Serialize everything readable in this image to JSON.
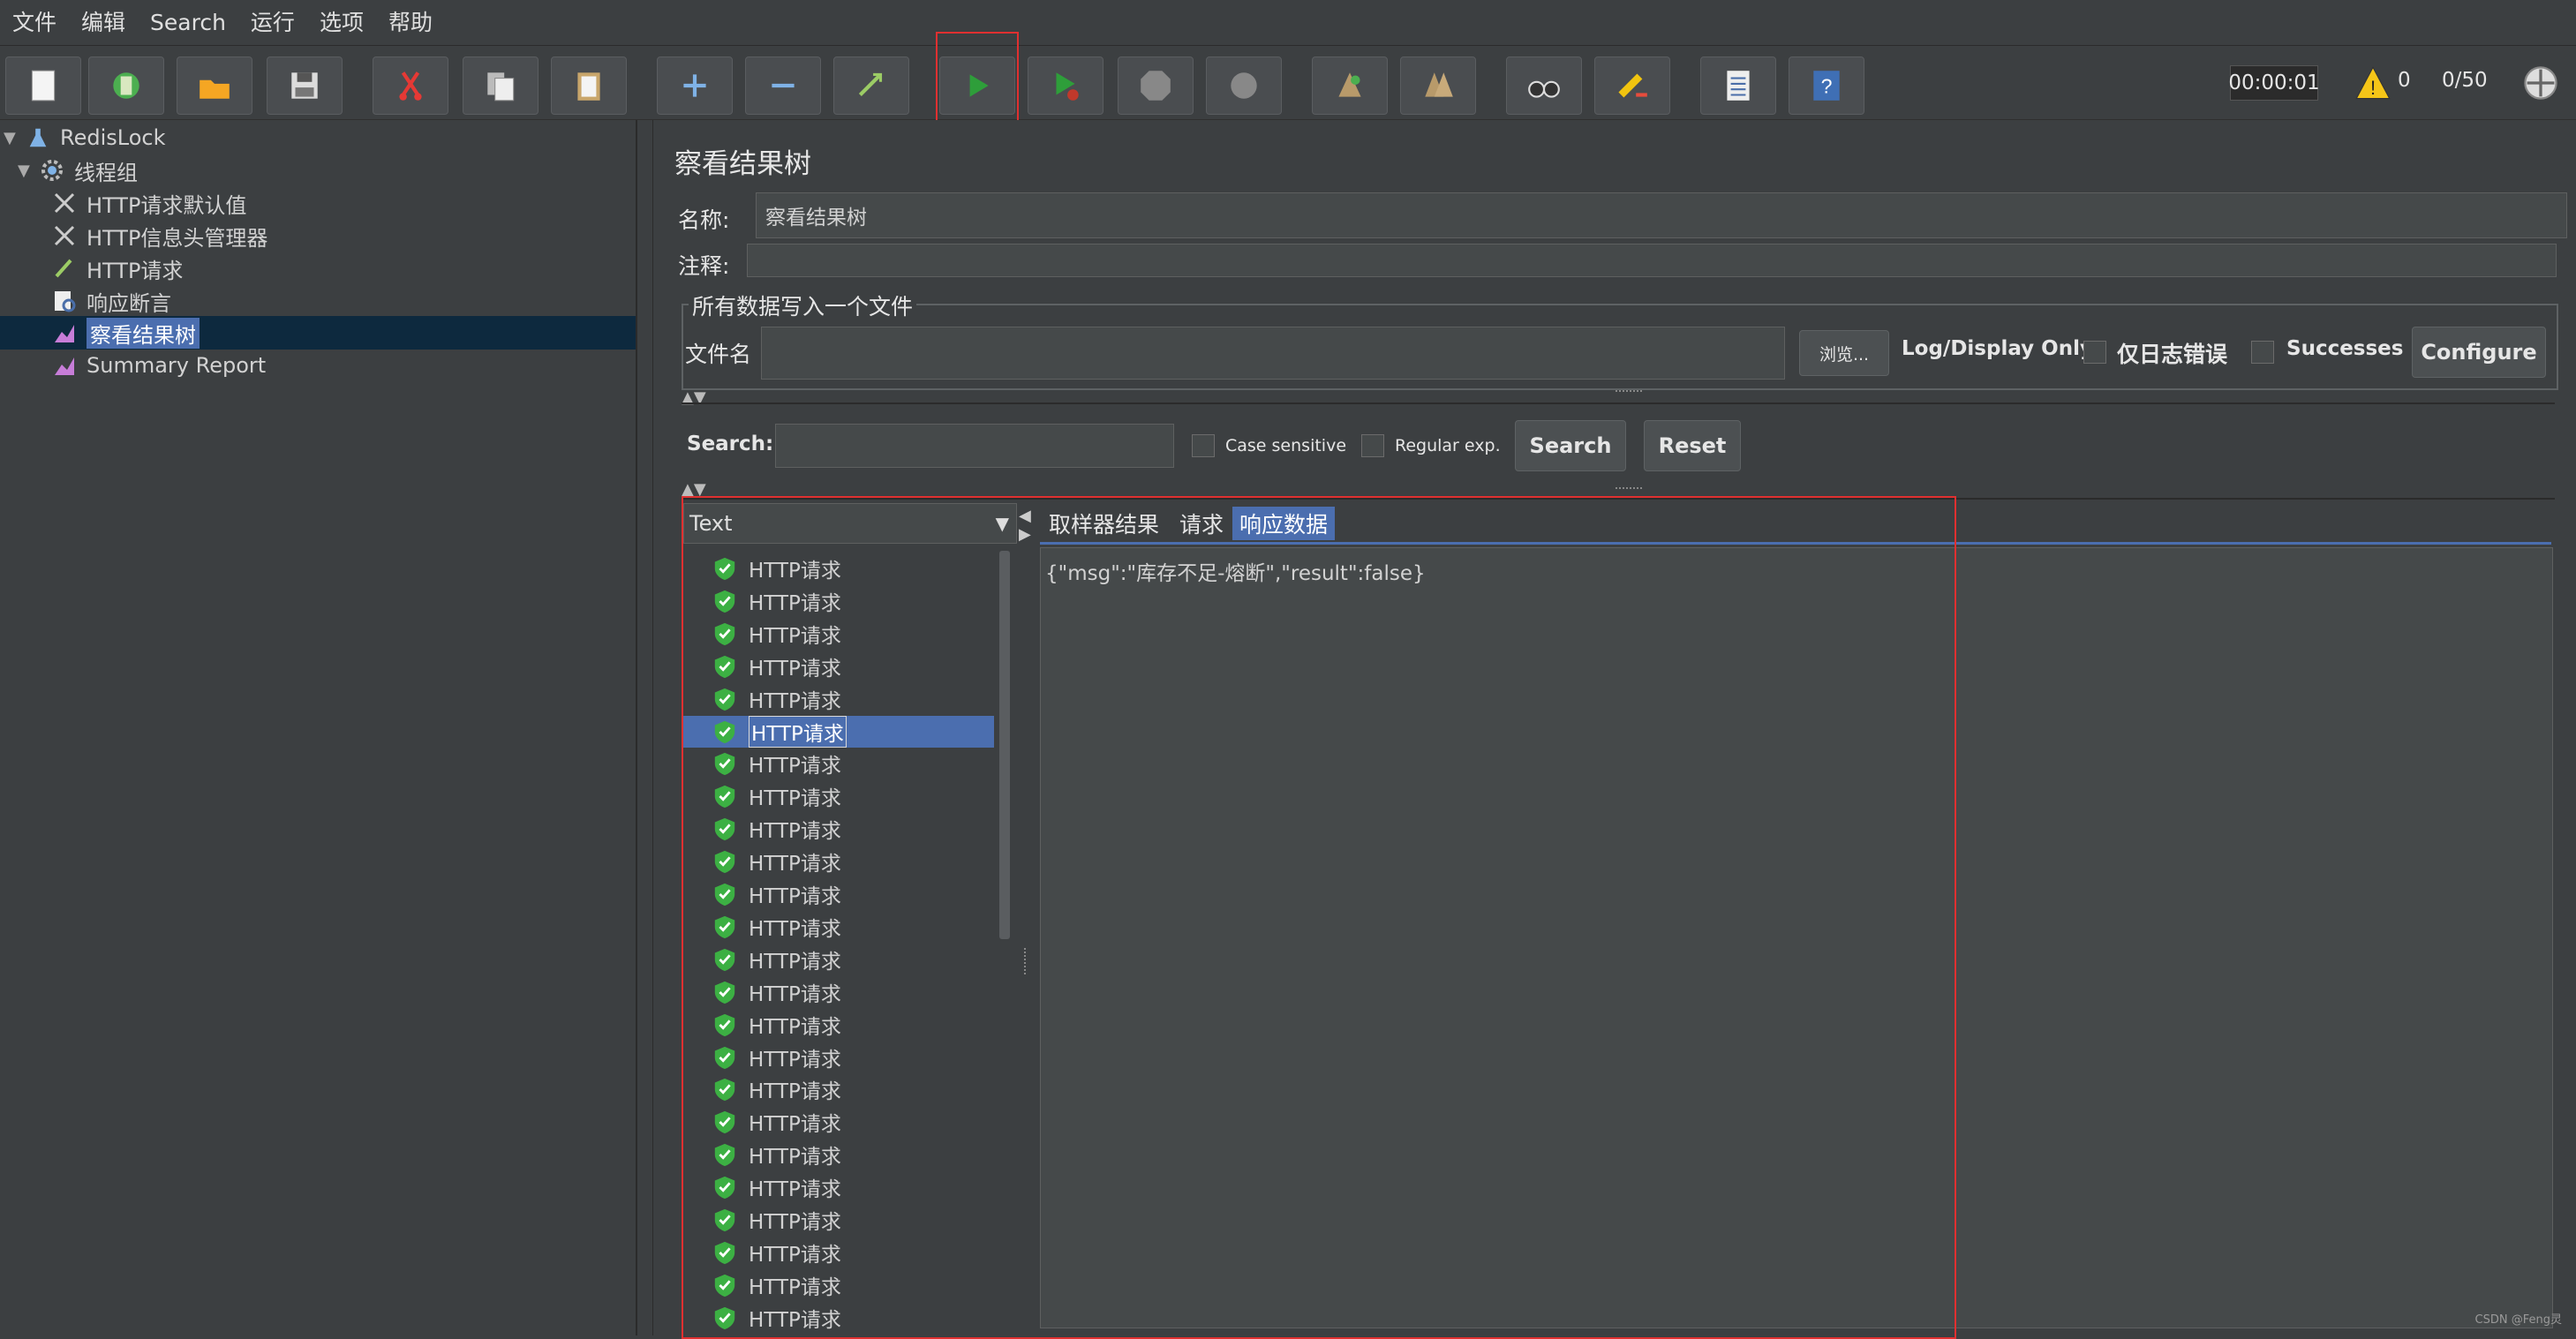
{
  "menu": [
    "文件",
    "编辑",
    "Search",
    "运行",
    "选项",
    "帮助"
  ],
  "toolbar": {
    "timer": "00:00:01",
    "warnings": "0",
    "threads": "0/50",
    "icons": [
      "new-icon",
      "templates-icon",
      "open-icon",
      "save-icon",
      "cut-icon",
      "copy-icon",
      "paste-icon",
      "expand-icon",
      "collapse-icon",
      "toggle-icon",
      "run-icon",
      "run-no-pause-icon",
      "stop-icon",
      "shutdown-icon",
      "clear-icon",
      "clear-all-icon",
      "search-icon",
      "reset-search-icon",
      "function-helper-icon",
      "help-icon"
    ]
  },
  "tree": {
    "items": [
      {
        "label": "RedisLock",
        "icon": "testplan-icon"
      },
      {
        "label": "线程组",
        "icon": "gear-icon"
      },
      {
        "label": "HTTP请求默认值",
        "icon": "tools-icon"
      },
      {
        "label": "HTTP信息头管理器",
        "icon": "tools-icon"
      },
      {
        "label": "HTTP请求",
        "icon": "pen-icon"
      },
      {
        "label": "响应断言",
        "icon": "assertion-icon"
      },
      {
        "label": "察看结果树",
        "icon": "chart-icon"
      },
      {
        "label": "Summary Report",
        "icon": "chart-icon"
      }
    ]
  },
  "panel": {
    "title": "察看结果树",
    "name_label": "名称:",
    "name_value": "察看结果树",
    "comment_label": "注释:",
    "fieldset_legend": "所有数据写入一个文件",
    "filename_label": "文件名",
    "browse_button": "浏览...",
    "log_display_label": "Log/Display Only:",
    "errors_label": "仅日志错误",
    "successes_label": "Successes",
    "configure_button": "Configure"
  },
  "search": {
    "label": "Search:",
    "case_label": "Case sensitive",
    "regex_label": "Regular exp.",
    "search_button": "Search",
    "reset_button": "Reset"
  },
  "results": {
    "renderer": "Text",
    "item_label": "HTTP请求",
    "item_count": 24,
    "selected_index": 5,
    "tabs": [
      "取样器结果",
      "请求",
      "响应数据"
    ],
    "active_tab": 2,
    "response": "{\"msg\":\"库存不足-熔断\",\"result\":false}"
  },
  "watermark": "CSDN @Feng灵",
  "colors": {
    "accent": "#4b6eaf",
    "highlight_border": "#e03030",
    "background": "#3c3f41",
    "success_icon": "#3cb043"
  }
}
